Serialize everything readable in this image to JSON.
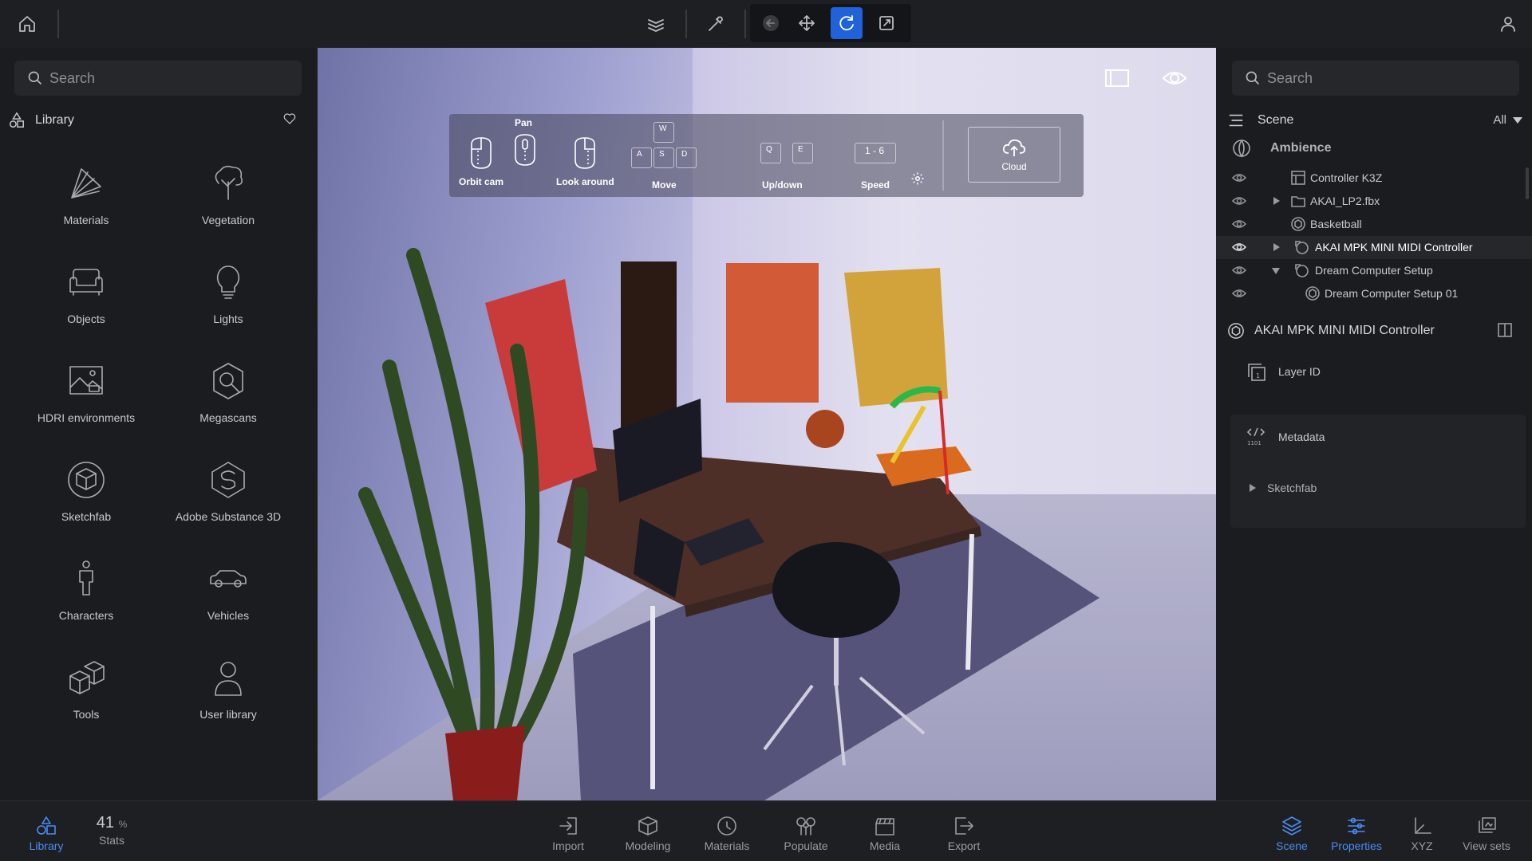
{
  "left_panel": {
    "search_placeholder": "Search",
    "library_title": "Library",
    "categories": [
      {
        "label": "Materials",
        "icon": "materials-icon"
      },
      {
        "label": "Vegetation",
        "icon": "tree-icon"
      },
      {
        "label": "Objects",
        "icon": "sofa-icon"
      },
      {
        "label": "Lights",
        "icon": "bulb-icon"
      },
      {
        "label": "HDRI environments",
        "icon": "hdri-icon"
      },
      {
        "label": "Megascans",
        "icon": "megascans-icon"
      },
      {
        "label": "Sketchfab",
        "icon": "sketchfab-icon"
      },
      {
        "label": "Adobe Substance 3D",
        "icon": "substance-icon"
      },
      {
        "label": "Characters",
        "icon": "person-icon"
      },
      {
        "label": "Vehicles",
        "icon": "car-icon"
      },
      {
        "label": "Tools",
        "icon": "cubes-icon"
      },
      {
        "label": "User library",
        "icon": "user-icon"
      }
    ]
  },
  "viewport": {
    "help": {
      "orbit_cam": "Orbit cam",
      "pan": "Pan",
      "look_around": "Look around",
      "move": "Move",
      "up_down": "Up/down",
      "speed": "Speed",
      "speed_keys": "1 - 6",
      "cloud": "Cloud",
      "keys": {
        "w": "W",
        "a": "A",
        "s": "S",
        "d": "D",
        "q": "Q",
        "e": "E"
      }
    }
  },
  "right_panel": {
    "search_placeholder": "Search",
    "scene_title": "Scene",
    "filter": "All",
    "ambience": "Ambience",
    "tree": [
      {
        "label": "Controller K3Z"
      },
      {
        "label": "AKAI_LP2.fbx"
      },
      {
        "label": "Basketball"
      },
      {
        "label": "AKAI MPK MINI MIDI Controller"
      },
      {
        "label": "Dream Computer Setup"
      },
      {
        "label": "Dream Computer Setup 01"
      }
    ],
    "properties": {
      "title": "AKAI MPK MINI MIDI Controller",
      "layer_id": "Layer ID",
      "metadata": "Metadata",
      "sketchfab": "Sketchfab"
    }
  },
  "bottom_bar": {
    "library": "Library",
    "stats_value": "41",
    "stats_unit": "%",
    "stats": "Stats",
    "center": [
      "Import",
      "Modeling",
      "Materials",
      "Populate",
      "Media",
      "Export"
    ],
    "right": [
      "Scene",
      "Properties",
      "XYZ",
      "View sets"
    ]
  },
  "colors": {
    "accent": "#1f62d9",
    "active_text": "#4b8cf5",
    "background": "#1b1c1f"
  }
}
